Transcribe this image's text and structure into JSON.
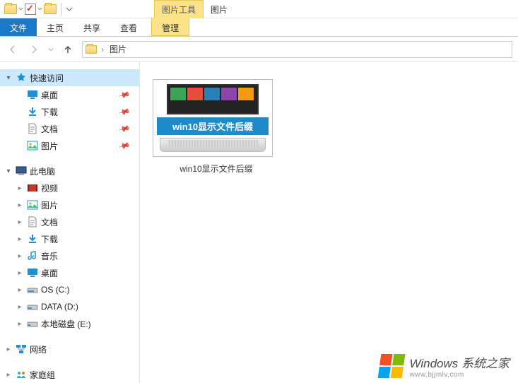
{
  "titlebar": {
    "context_tab": "图片工具",
    "window_title": "图片"
  },
  "ribbon": {
    "file": "文件",
    "tabs": [
      "主页",
      "共享",
      "查看"
    ],
    "context": "管理"
  },
  "address": {
    "crumbs": [
      "图片"
    ]
  },
  "sidebar": {
    "quick_access": {
      "label": "快速访问",
      "items": [
        {
          "icon": "desktop",
          "label": "桌面",
          "pinned": true
        },
        {
          "icon": "download",
          "label": "下载",
          "pinned": true
        },
        {
          "icon": "document",
          "label": "文档",
          "pinned": true
        },
        {
          "icon": "picture",
          "label": "图片",
          "pinned": true
        }
      ]
    },
    "this_pc": {
      "label": "此电脑",
      "items": [
        {
          "icon": "video",
          "label": "视频"
        },
        {
          "icon": "picture",
          "label": "图片"
        },
        {
          "icon": "document",
          "label": "文档"
        },
        {
          "icon": "download",
          "label": "下载"
        },
        {
          "icon": "music",
          "label": "音乐"
        },
        {
          "icon": "desktop",
          "label": "桌面"
        },
        {
          "icon": "drive",
          "label": "OS (C:)"
        },
        {
          "icon": "drive",
          "label": "DATA (D:)"
        },
        {
          "icon": "drive",
          "label": "本地磁盘 (E:)"
        }
      ]
    },
    "network": {
      "label": "网络"
    },
    "homegroup": {
      "label": "家庭组"
    }
  },
  "content": {
    "items": [
      {
        "banner": "win10显示文件后缀",
        "label": "win10显示文件后缀"
      }
    ]
  },
  "watermark": {
    "line1": "Windows 系统之家",
    "line2": "www.bjjmlv.com"
  }
}
